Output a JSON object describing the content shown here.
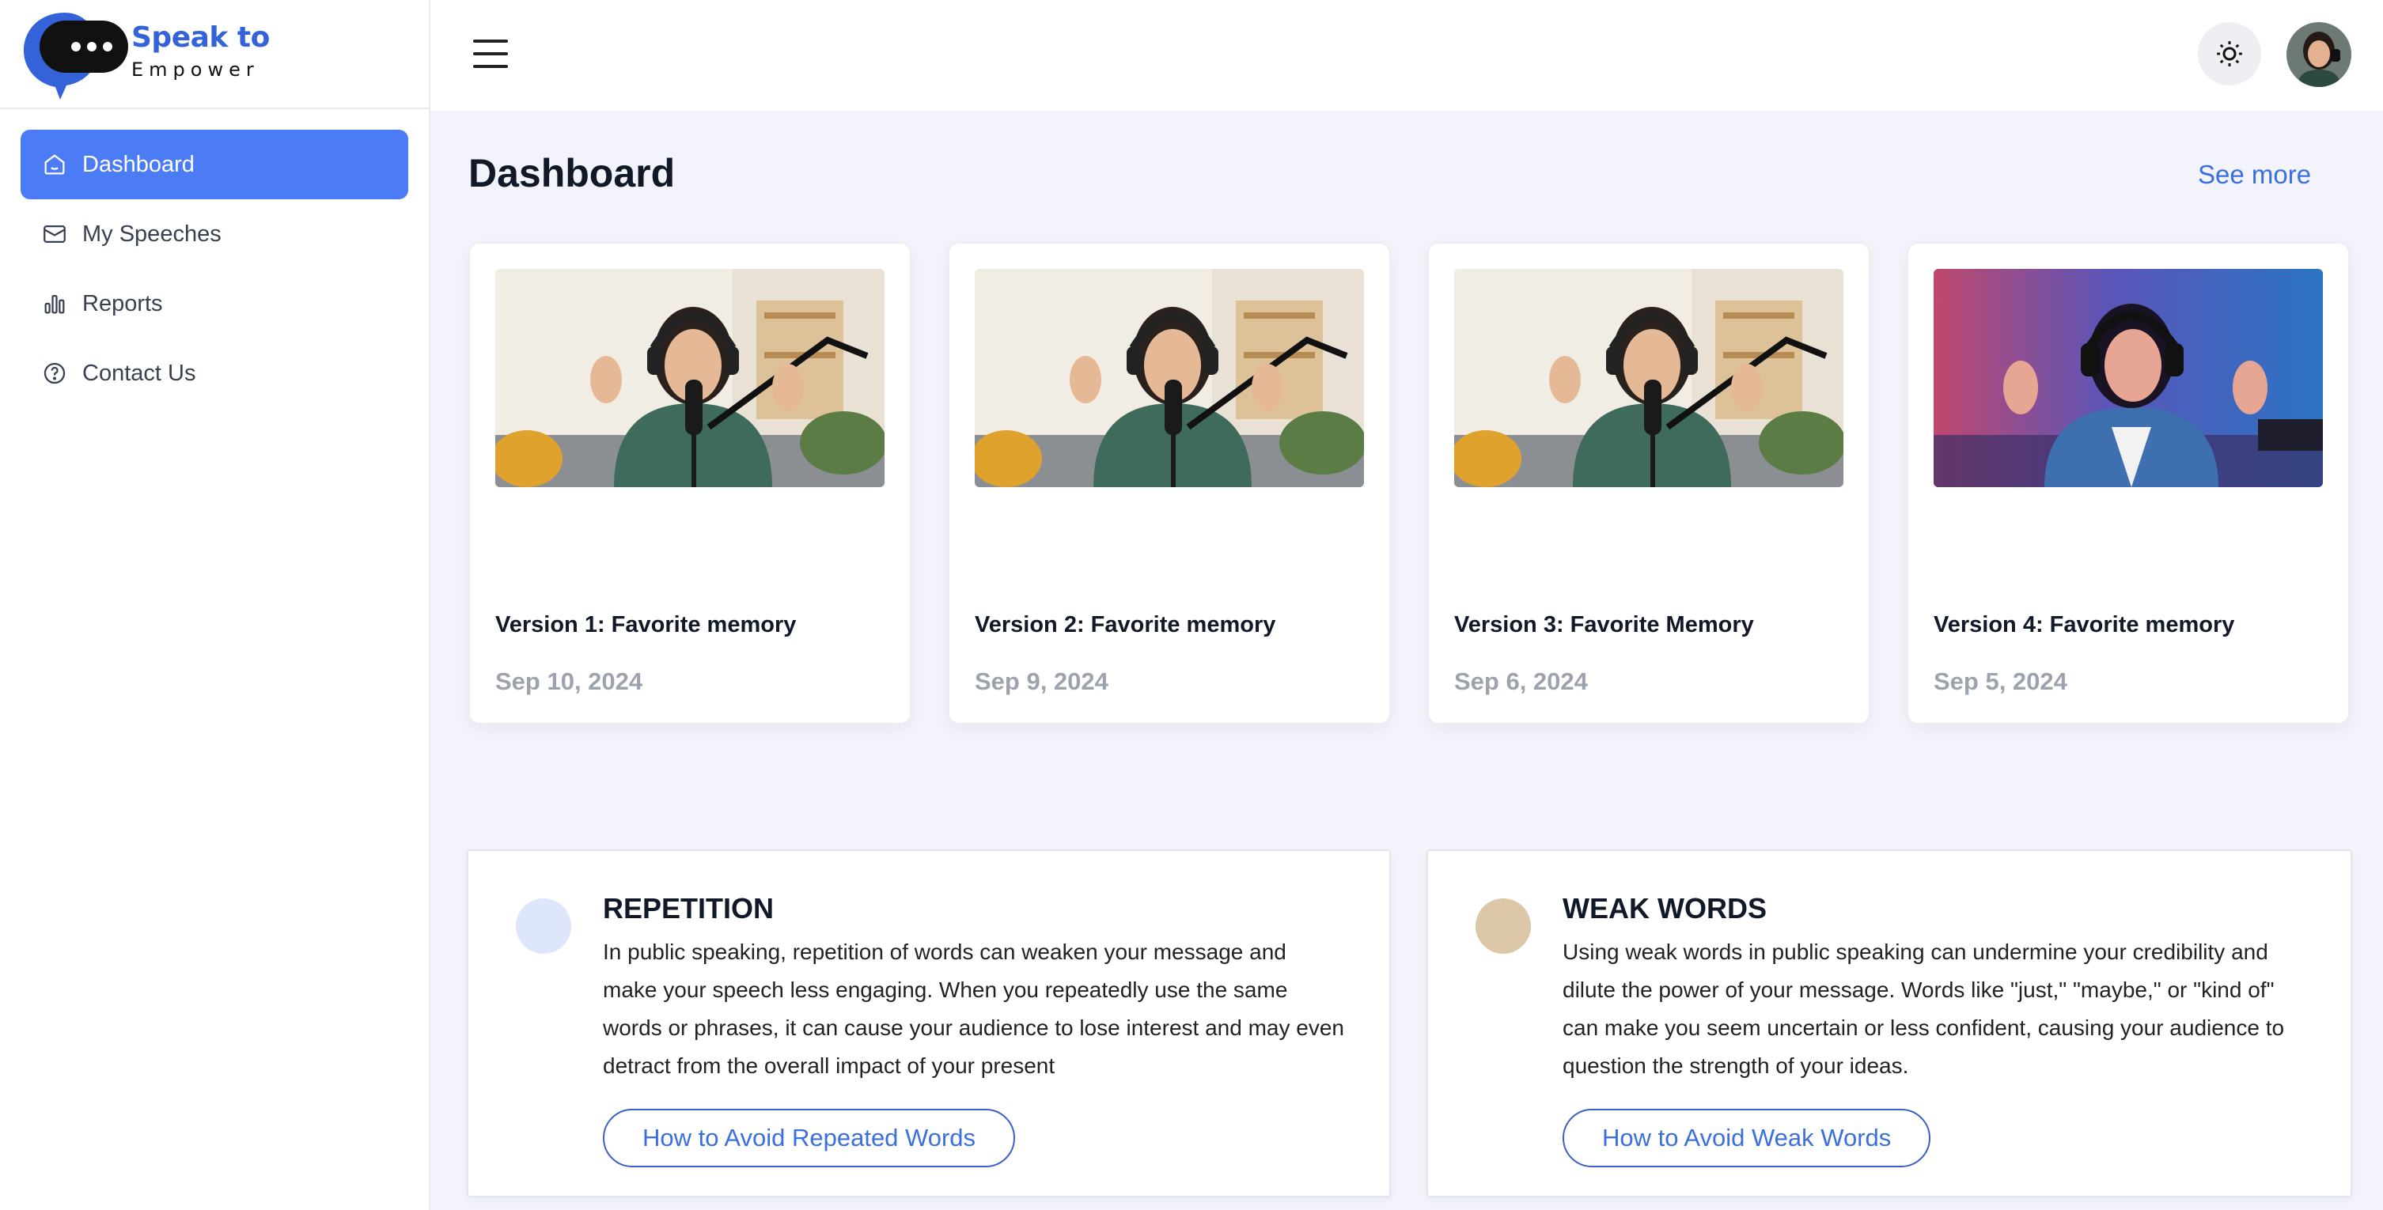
{
  "brand": {
    "line1": "Speak to",
    "line2": "Empower"
  },
  "sidebar": {
    "items": [
      {
        "label": "Dashboard",
        "icon": "home-icon",
        "active": true
      },
      {
        "label": "My Speeches",
        "icon": "mail-icon",
        "active": false
      },
      {
        "label": "Reports",
        "icon": "bar-chart-icon",
        "active": false
      },
      {
        "label": "Contact Us",
        "icon": "help-circle-icon",
        "active": false
      }
    ]
  },
  "topbar": {
    "menu_icon": "hamburger-icon",
    "theme_icon": "sun-icon",
    "avatar": "user-avatar"
  },
  "main": {
    "title": "Dashboard",
    "see_more": "See more",
    "speeches": [
      {
        "title": "Version 1: Favorite memory",
        "date": "Sep 10, 2024"
      },
      {
        "title": "Version 2: Favorite memory",
        "date": "Sep 9, 2024"
      },
      {
        "title": "Version 3: Favorite Memory",
        "date": "Sep 6, 2024"
      },
      {
        "title": "Version 4: Favorite memory",
        "date": "Sep 5, 2024"
      }
    ],
    "tips": [
      {
        "title": "REPETITION",
        "body": "In public speaking, repetition of words can weaken your message and make your speech less engaging. When you repeatedly use the same words or phrases, it can cause your audience to lose interest and may even detract from the overall impact of your present",
        "button": "How to Avoid Repeated Words",
        "dot_color": "#dde6fb"
      },
      {
        "title": "WEAK WORDS",
        "body": "Using weak words in public speaking can undermine your credibility and dilute the power of your message. Words like \"just,\" \"maybe,\" or \"kind of\" can make you seem uncertain or less confident, causing your audience to question the strength of your ideas.",
        "button": "How to Avoid Weak Words",
        "dot_color": "#dcc7a8"
      }
    ]
  },
  "colors": {
    "accent": "#4b7bf5",
    "brand_blue": "#3463d9",
    "link": "#3b6fe0",
    "bg": "#f3f4fb"
  }
}
